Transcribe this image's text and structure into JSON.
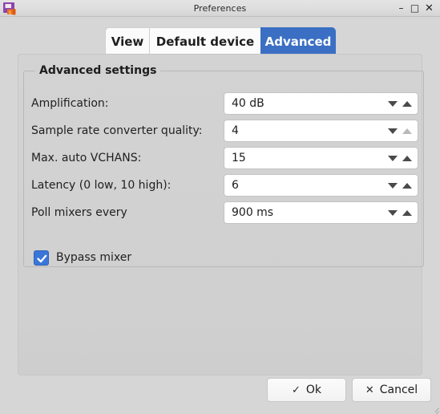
{
  "window": {
    "title": "Preferences",
    "icon": "app-icon",
    "controls": {
      "minimize": "–",
      "maximize": "□",
      "close": "✕"
    }
  },
  "tabs": [
    {
      "label": "View",
      "selected": false
    },
    {
      "label": "Default device",
      "selected": false
    },
    {
      "label": "Advanced",
      "selected": true
    }
  ],
  "group": {
    "title": "Advanced settings",
    "rows": [
      {
        "label": "Amplification:",
        "value": "40 dB",
        "up_disabled": false
      },
      {
        "label": "Sample rate converter quality:",
        "value": "4",
        "up_disabled": true
      },
      {
        "label": "Max. auto VCHANS:",
        "value": "15",
        "up_disabled": false
      },
      {
        "label": "Latency (0 low, 10 high):",
        "value": "6",
        "up_disabled": false
      },
      {
        "label": "Poll mixers every",
        "value": "900 ms",
        "up_disabled": false
      }
    ],
    "checkbox": {
      "label": "Bypass mixer",
      "checked": true
    }
  },
  "buttons": {
    "ok": {
      "label": "Ok",
      "glyph": "✓"
    },
    "cancel": {
      "label": "Cancel",
      "glyph": "✕"
    }
  },
  "colors": {
    "accent": "#3a6fc4",
    "checkbox": "#3a76d8",
    "window_bg": "#d6d6d6",
    "panel_bg": "#d2d2d2",
    "field_bg": "#ffffff"
  }
}
